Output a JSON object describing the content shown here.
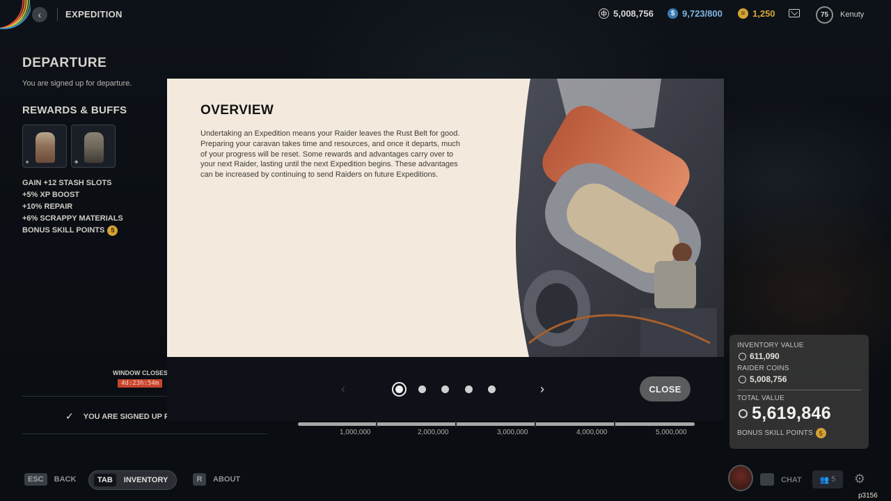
{
  "header": {
    "page_name": "EXPEDITION",
    "coins": "5,008,756",
    "credits": "9,723/800",
    "materials": "1,250",
    "level": "75",
    "username": "Kenuty"
  },
  "left": {
    "departure_title": "DEPARTURE",
    "departure_sub": "You are signed up for departure.",
    "rewards_title": "REWARDS & BUFFS",
    "buffs": [
      "GAIN +12 STASH SLOTS",
      "+5% XP BOOST",
      "+10% REPAIR",
      "+6% SCRAPPY MATERIALS",
      "BONUS SKILL POINTS"
    ],
    "bonus_points": "5",
    "window_closes_label": "WINDOW CLOSES",
    "timer": "4d:23h:54m",
    "signed_up": "YOU ARE SIGNED UP F"
  },
  "values": {
    "inventory_label": "INVENTORY VALUE",
    "inventory_value": "611,090",
    "coins_label": "RAIDER COINS",
    "coins_value": "5,008,756",
    "total_label": "TOTAL VALUE",
    "total_value": "5,619,846",
    "bonus_label": "BONUS SKILL POINTS",
    "bonus_value": "5"
  },
  "timeline": {
    "labels": [
      "1,000,000",
      "2,000,000",
      "3,000,000",
      "4,000,000",
      "5,000,000"
    ]
  },
  "modal": {
    "title": "OVERVIEW",
    "body": "Undertaking an Expedition means your Raider leaves the Rust Belt for good. Preparing your caravan takes time and resources, and once it departs, much of your progress will be reset. Some rewards and advantages carry over to your next Raider, lasting until the next Expedition begins. These advantages can be increased by continuing to send Raiders on future Expeditions.",
    "close_label": "CLOSE",
    "page_count": 5,
    "active_page": 1
  },
  "footer": {
    "back_key": "ESC",
    "back_label": "BACK",
    "inventory_key": "TAB",
    "inventory_label": "INVENTORY",
    "about_key": "R",
    "about_label": "ABOUT",
    "chat_label": "CHAT",
    "friends_count": "5",
    "build_code": "p3156"
  },
  "colors": {
    "accent_gold": "#d4a236",
    "timer_red": "#c7452c",
    "modal_bg": "#f3eadd"
  }
}
